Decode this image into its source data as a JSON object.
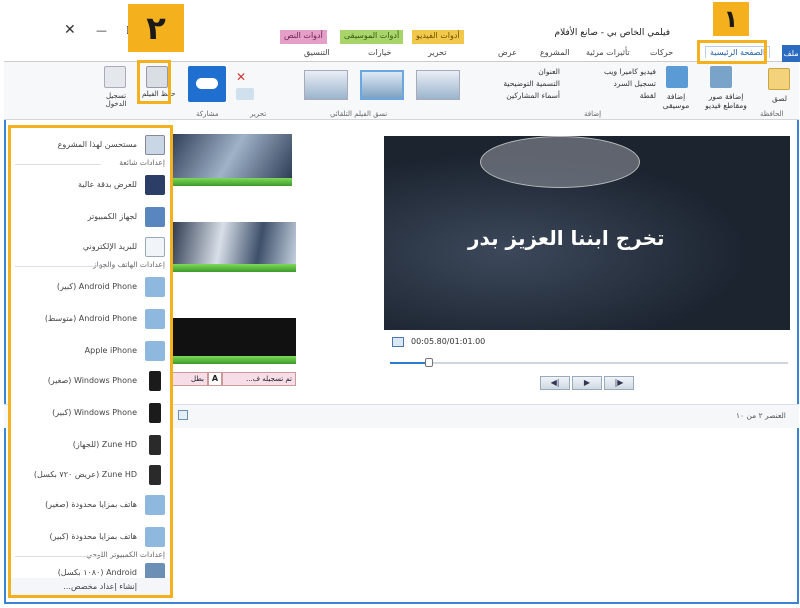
{
  "title_bar": {
    "title": "فيلمي الخاص بي - صانع الأفلام",
    "close_glyph": "✕",
    "minimize_glyph": "—",
    "maximize_glyph": "☐"
  },
  "context_tabs": [
    {
      "label": "أدوات الفيديو",
      "color": "#f2d84b"
    },
    {
      "label": "أدوات الموسيقى",
      "color": "#a8d46a"
    },
    {
      "label": "أدوات النص",
      "color": "#e4a0c8"
    }
  ],
  "tabs": {
    "file": "ملف",
    "home": "الصفحة الرئيسية",
    "animations": "حركات",
    "visual_effects": "تأثيرات مرئية",
    "project": "المشروع",
    "view": "عرض",
    "edit": "تحرير",
    "options": "خيارات",
    "format": "التنسيق"
  },
  "ribbon": {
    "add_videos_photos": "إضافة صور ومقاطع فيديو",
    "add_music": "إضافة موسيقى",
    "webcam_video": "فيديو كاميرا ويب",
    "record_narration": "تسجيل السرد",
    "snapshot": "لقطة",
    "title": "العنوان",
    "caption": "التسمية التوضيحية",
    "credits": "أسماء المشاركين",
    "add_group": "إضافة",
    "autoMovie_group": "نسق الفيلم التلقائي",
    "edit_group": "تحرير",
    "sharing_group": "مشاركة",
    "save_movie": "حفظ الفيلم",
    "sign_in": "تسجيل الدخول",
    "clipboard_group": "الحافظة",
    "paste": "لصق"
  },
  "preview": {
    "caption": "تخرج ابننا العزيز بدر",
    "timecode": "00:05.80/01:01.00",
    "prev_frame": "◀|",
    "play": "▶",
    "next_frame": "|▶"
  },
  "status": {
    "item_count": "العنصر ٢ من ١٠"
  },
  "storyboard": {
    "caption_chip_1": "تم تسجيله ف...",
    "caption_chip_2": "بطل"
  },
  "save_menu": {
    "recommended": "مستحسن لهذا المشروع",
    "common_settings": "إعدادات شائعة",
    "high_def": "للعرض بدقة عالية",
    "for_computer": "لجهاز الكمبيوتر",
    "for_email": "للبريد الإلكتروني",
    "phone_device_settings": "إعدادات الهاتف والجهاز",
    "android_large": "Android Phone (كبير)",
    "android_medium": "Android Phone (متوسط)",
    "apple_iphone": "Apple iPhone",
    "wp_small": "Windows Phone (صغير)",
    "wp_large": "Windows Phone (كبير)",
    "zune_device": "Zune HD (للجهاز)",
    "zune_wide": "Zune HD (عريض ٧٢٠ بكسل)",
    "basic_phone_small": "هاتف بمزايا محدودة (صغير)",
    "basic_phone_large": "هاتف بمزايا محدودة (كبير)",
    "tablet_settings": "إعدادات الكمبيوتر اللوحي",
    "android_1080": "Android (١٠٨٠ بكسل)",
    "create_custom": "إنشاء إعداد مخصص..."
  },
  "callouts": {
    "badge_1": "١",
    "badge_2": "٢"
  },
  "colors": {
    "accent": "#f5b01d",
    "window_border": "#3b84d3",
    "file_tab": "#2b6cc0"
  }
}
